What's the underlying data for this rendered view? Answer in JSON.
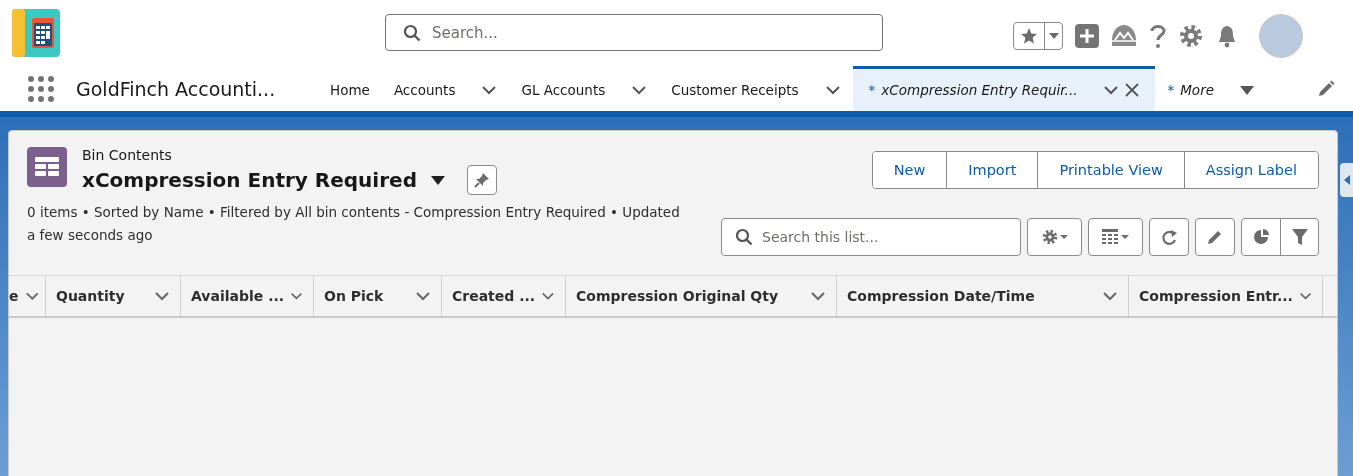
{
  "header": {
    "search": {
      "placeholder": "Search..."
    }
  },
  "nav": {
    "app_name": "GoldFinch Accounti...",
    "items": [
      {
        "label": "Home",
        "has_menu": false,
        "closable": false,
        "italic": false,
        "selected": false
      },
      {
        "label": "Accounts",
        "has_menu": true,
        "closable": false,
        "italic": false,
        "selected": false
      },
      {
        "label": "GL Accounts",
        "has_menu": true,
        "closable": false,
        "italic": false,
        "selected": false
      },
      {
        "label": "Customer Receipts",
        "has_menu": true,
        "closable": false,
        "italic": false,
        "selected": false
      },
      {
        "label": "xCompression Entry Requir...",
        "prefix": "*",
        "has_menu": true,
        "closable": true,
        "italic": true,
        "selected": true
      },
      {
        "label": "More",
        "prefix": "*",
        "has_menu": true,
        "closable": false,
        "italic": true,
        "selected": false
      }
    ]
  },
  "list_view": {
    "object_label": "Bin Contents",
    "title": "xCompression Entry Required",
    "meta": "0 items • Sorted by Name • Filtered by All bin contents - Compression Entry Required • Updated a few seconds ago",
    "actions": [
      "New",
      "Import",
      "Printable View",
      "Assign Label"
    ],
    "search": {
      "placeholder": "Search this list..."
    },
    "columns": [
      {
        "label": "e"
      },
      {
        "label": "Quantity"
      },
      {
        "label": "Available ..."
      },
      {
        "label": "On Pick"
      },
      {
        "label": "Created ..."
      },
      {
        "label": "Compression Original Qty"
      },
      {
        "label": "Compression Date/Time"
      },
      {
        "label": "Compression Entr..."
      }
    ]
  }
}
